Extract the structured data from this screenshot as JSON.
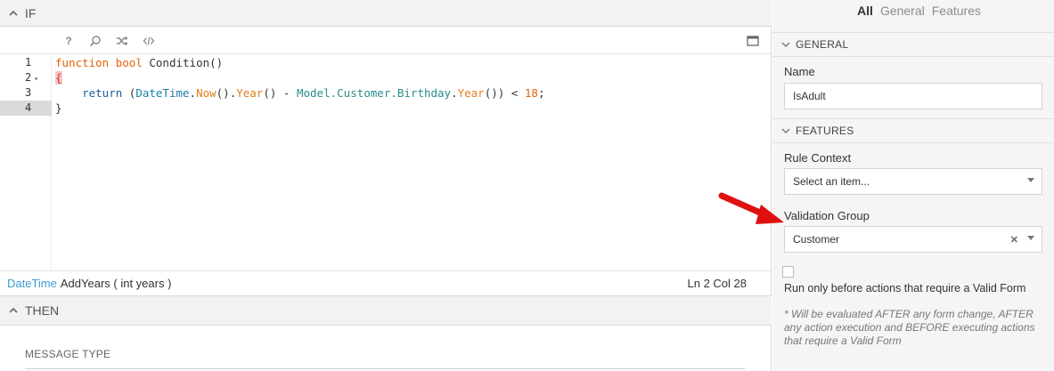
{
  "if_section": {
    "title": "IF"
  },
  "toolbar": {
    "icons": [
      "help-icon",
      "search-icon",
      "shuffle-icon",
      "code-icon",
      "maximize-icon"
    ],
    "help_glyph": "?"
  },
  "editor": {
    "line_numbers": [
      "1",
      "2",
      "3",
      "4"
    ],
    "fold_glyph": "▾",
    "active_line": "4",
    "code": {
      "line1": {
        "kw1": "function",
        "kw2": "bool",
        "rest": " Condition()"
      },
      "line2": {
        "brace": "{"
      },
      "line3": {
        "ret": "return",
        "p1": " (",
        "t1": "DateTime",
        "d1": ".",
        "m1": "Now",
        "p2": "().",
        "m2": "Year",
        "p3": "() - ",
        "mo1": "Model.Customer.Birthday",
        "d2": ".",
        "m3": "Year",
        "p4": "()) < ",
        "num": "18",
        "p5": ";"
      },
      "line4": {
        "brace": "}"
      }
    }
  },
  "status": {
    "sig_type": "DateTime",
    "sig_rest": "AddYears ( int years )",
    "position": "Ln 2 Col 28"
  },
  "then_section": {
    "title": "THEN",
    "message_type_label": "MESSAGE TYPE"
  },
  "right_panel": {
    "tabs": [
      "All",
      "General",
      "Features"
    ],
    "general_header": "GENERAL",
    "name_label": "Name",
    "name_value": "IsAdult",
    "features_header": "FEATURES",
    "rule_context_label": "Rule Context",
    "rule_context_value": "Select an item...",
    "validation_group_label": "Validation Group",
    "validation_group_value": "Customer",
    "clear_glyph": "✕",
    "checkbox_label": "Run only before actions that require a Valid Form",
    "note": "* Will be evaluated AFTER any form change, AFTER any action execution and BEFORE executing actions that require a Valid Form"
  },
  "colors": {
    "accent": "#3b9bd1",
    "arrow": "#e01010",
    "keyword": "#e36209"
  }
}
